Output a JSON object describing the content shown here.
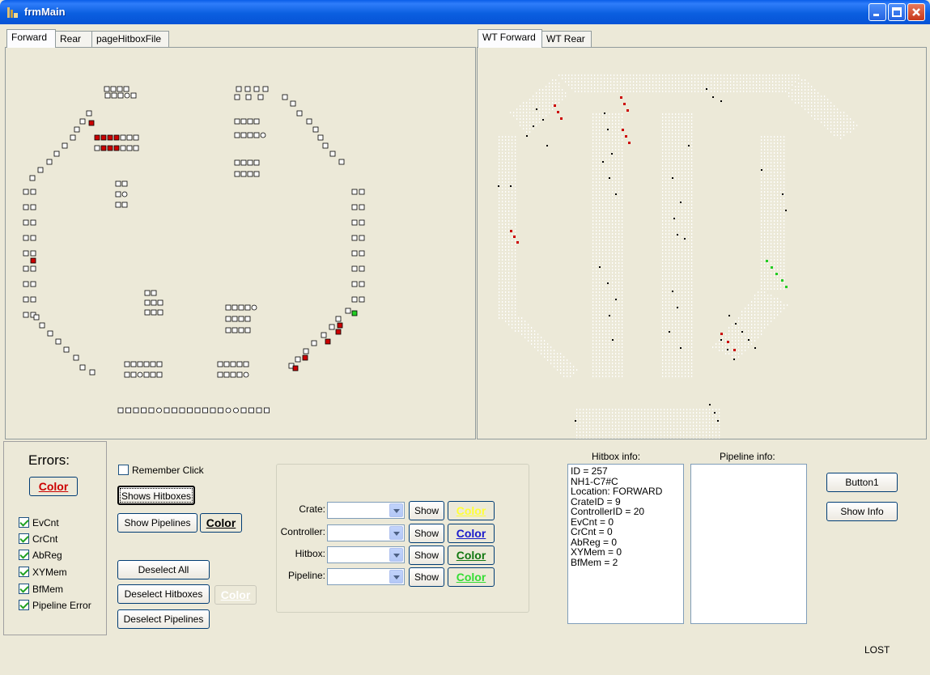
{
  "window": {
    "title": "frmMain"
  },
  "left_tabs": [
    {
      "label": "Forward"
    },
    {
      "label": "Rear"
    },
    {
      "label": "pageHitboxFile"
    }
  ],
  "right_tabs": [
    {
      "label": "WT Forward"
    },
    {
      "label": "WT Rear"
    }
  ],
  "errors": {
    "title": "Errors:",
    "color_label": "Color",
    "checks": [
      {
        "label": "EvCnt",
        "checked": true
      },
      {
        "label": "CrCnt",
        "checked": true
      },
      {
        "label": "AbReg",
        "checked": true
      },
      {
        "label": "XYMem",
        "checked": true
      },
      {
        "label": "BfMem",
        "checked": true
      },
      {
        "label": "Pipeline Error",
        "checked": true
      }
    ]
  },
  "controls": {
    "remember_click": "Remember Click",
    "shows_hitboxes": "Shows Hitboxes",
    "show_pipelines": "Show Pipelines",
    "pipelines_color": "Color",
    "deselect_all": "Deselect All",
    "deselect_hitboxes": "Deselect Hitboxes",
    "deselect_pipelines": "Deselect Pipelines",
    "disabled_color": "Color"
  },
  "filters": [
    {
      "label": "Crate:",
      "show": "Show",
      "color_label": "Color",
      "color": "#ffff33"
    },
    {
      "label": "Controller:",
      "show": "Show",
      "color_label": "Color",
      "color": "#1a1acc"
    },
    {
      "label": "Hitbox:",
      "show": "Show",
      "color_label": "Color",
      "color": "#117711"
    },
    {
      "label": "Pipeline:",
      "show": "Show",
      "color_label": "Color",
      "color": "#33dd33"
    }
  ],
  "hitbox_info": {
    "label": "Hitbox info:",
    "lines": [
      "ID = 257",
      "NH1-C7#C",
      "Location: FORWARD",
      "CrateID = 9",
      "ControllerID = 20",
      "EvCnt = 0",
      "CrCnt = 0",
      "AbReg = 0",
      "XYMem = 0",
      "BfMem = 2"
    ]
  },
  "pipeline_info": {
    "label": "Pipeline info:",
    "lines": []
  },
  "buttons": {
    "button1": "Button1",
    "show_info": "Show Info"
  },
  "status": {
    "text": "LOST"
  },
  "colors": {
    "error_red": "#cc0000",
    "highlight_green": "#22cc22",
    "title_blue": "#0a5ee8"
  }
}
